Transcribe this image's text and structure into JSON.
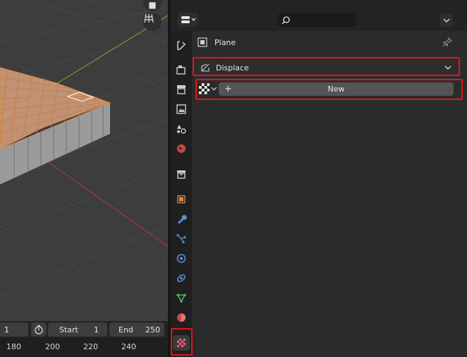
{
  "properties": {
    "object_name": "Plane",
    "texture_name": "Displace",
    "new_button_label": "New",
    "new_plus_glyph": "+",
    "header_icons": [
      "editor-type-icon",
      "search-icon",
      "chevron-down-icon"
    ],
    "tabs": [
      "tool-icon",
      "render-icon",
      "output-icon",
      "view-layer-icon",
      "scene-icon",
      "world-icon",
      "collection-icon",
      "object-icon",
      "modifier-icon",
      "particles-icon",
      "physics-icon",
      "constraints-icon",
      "data-icon",
      "material-icon",
      "texture-icon"
    ],
    "active_tab": "texture-icon"
  },
  "timeline": {
    "current_frame": "1",
    "start_label": "Start",
    "start_value": "1",
    "end_label": "End",
    "end_value": "250",
    "ruler_ticks": [
      "180",
      "200",
      "220",
      "240"
    ]
  },
  "colors": {
    "highlight_red": "#e8121b",
    "mesh_orange": "#d7a27c"
  }
}
